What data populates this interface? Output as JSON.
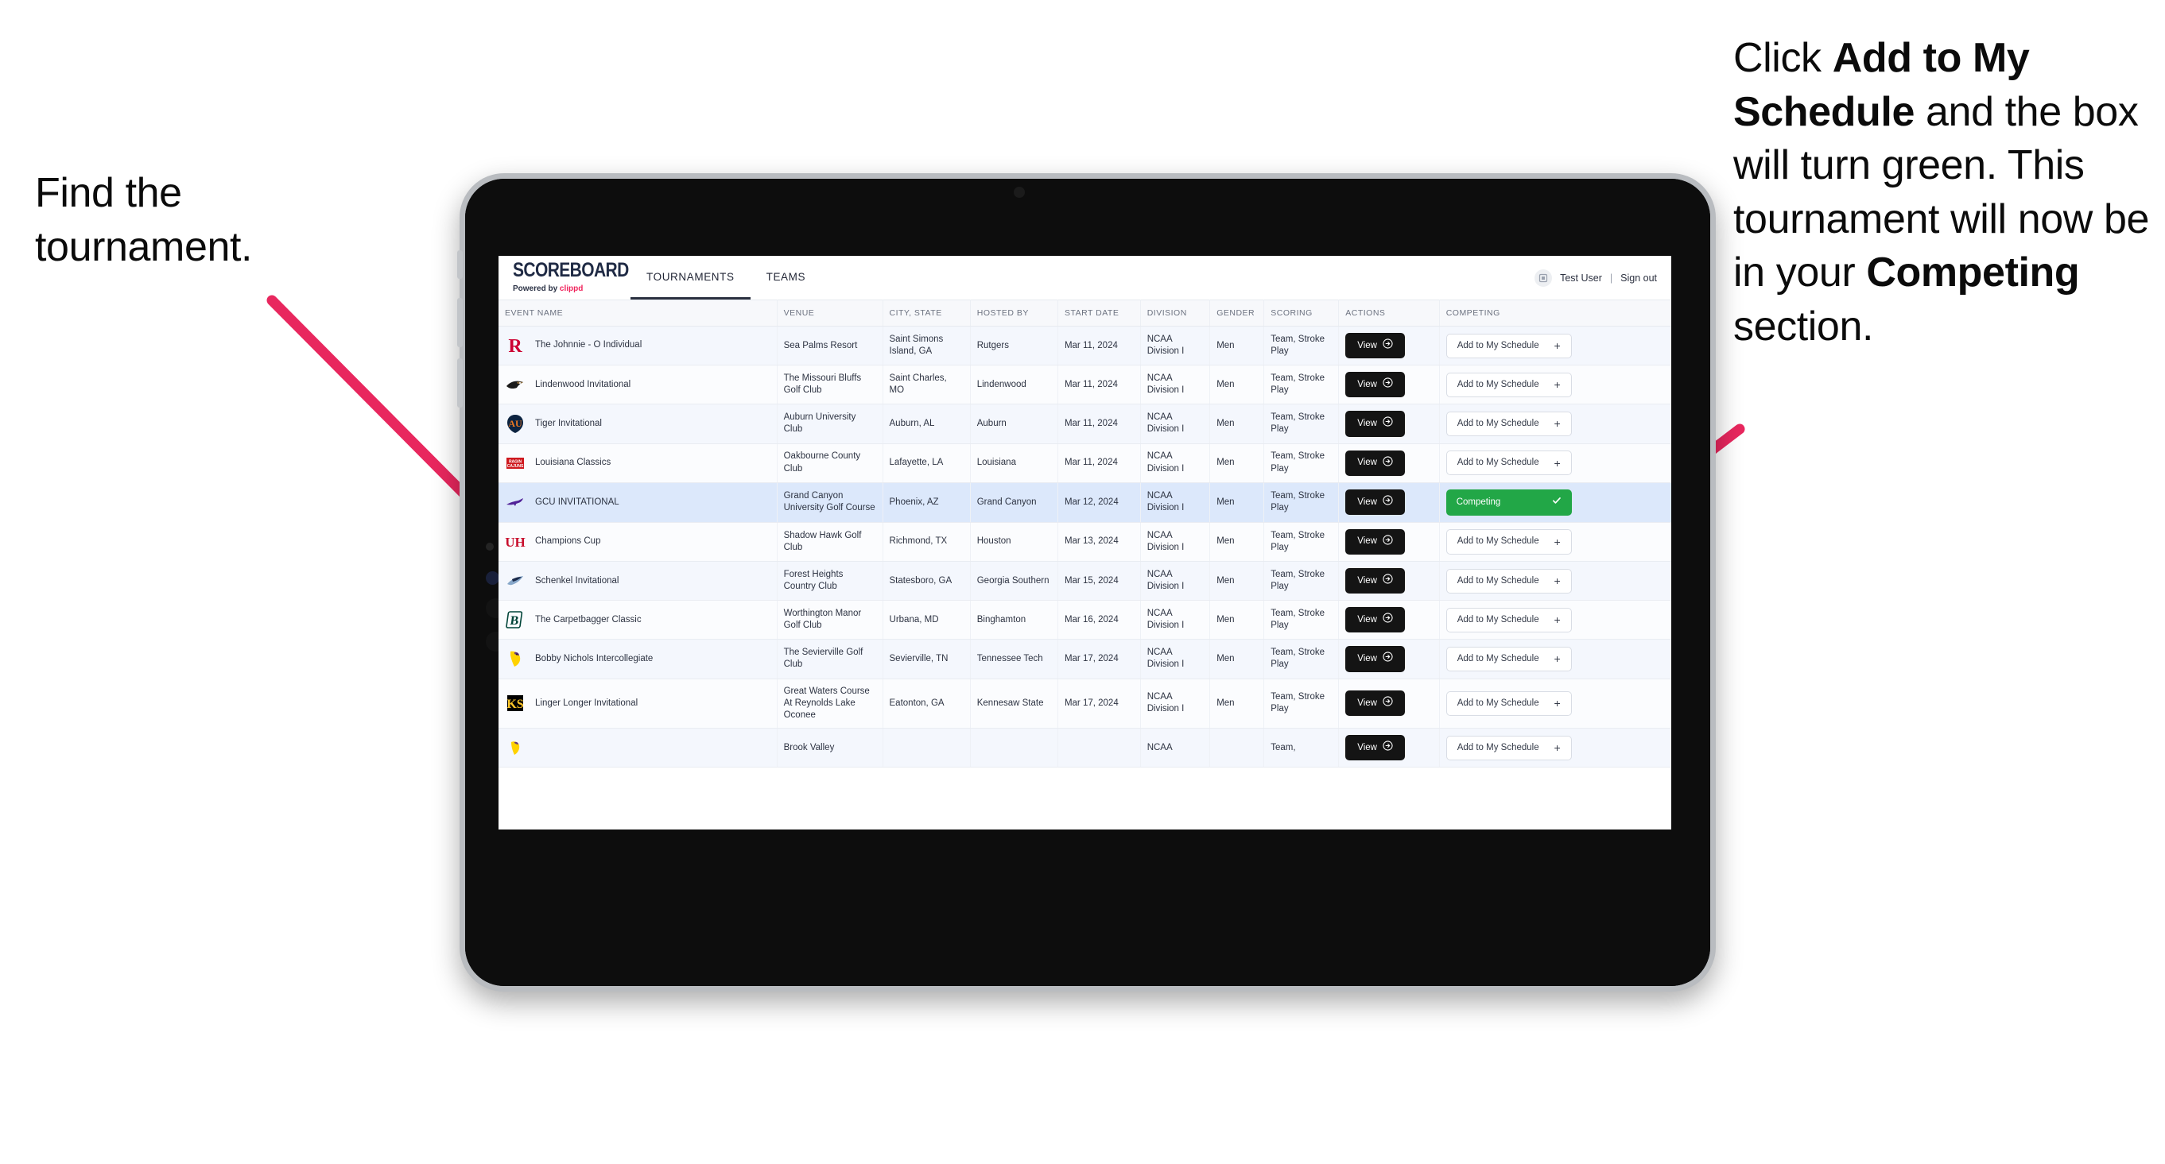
{
  "annotations": {
    "left": "Find the tournament.",
    "right_parts": [
      {
        "text": "Click ",
        "bold": false
      },
      {
        "text": "Add to My Schedule",
        "bold": true
      },
      {
        "text": " and the box will turn green. This tournament will now be in your ",
        "bold": false
      },
      {
        "text": "Competing",
        "bold": true
      },
      {
        "text": " section.",
        "bold": false
      }
    ]
  },
  "colors": {
    "arrow": "#e8275e",
    "competing_green": "#22a747",
    "clippd_pink": "#f0245c",
    "highlight_row": "#dce8fb",
    "view_button": "#141414"
  },
  "app": {
    "brand": {
      "title": "SCOREBOARD",
      "powered_prefix": "Powered by ",
      "powered_brand": "clippd"
    },
    "nav": [
      {
        "label": "TOURNAMENTS",
        "active": true
      },
      {
        "label": "TEAMS",
        "active": false
      }
    ],
    "user": {
      "name": "Test User",
      "separator": "|",
      "sign_out": "Sign out",
      "avatar_icon": "user-avatar-icon"
    },
    "table": {
      "columns": [
        "EVENT NAME",
        "VENUE",
        "CITY, STATE",
        "HOSTED BY",
        "START DATE",
        "DIVISION",
        "GENDER",
        "SCORING",
        "ACTIONS",
        "COMPETING"
      ],
      "view_label": "View",
      "add_label": "Add to My Schedule",
      "add_icon": "plus-icon",
      "competing_label": "Competing",
      "competing_icon": "check-icon",
      "rows": [
        {
          "event": "The Johnnie - O Individual",
          "venue": "Sea Palms Resort",
          "city": "Saint Simons Island, GA",
          "host": "Rutgers",
          "date": "Mar 11, 2024",
          "division": "NCAA Division I",
          "gender": "Men",
          "scoring": "Team, Stroke Play",
          "competing": false,
          "logo": "rutgers-r-logo"
        },
        {
          "event": "Lindenwood Invitational",
          "venue": "The Missouri Bluffs Golf Club",
          "city": "Saint Charles, MO",
          "host": "Lindenwood",
          "date": "Mar 11, 2024",
          "division": "NCAA Division I",
          "gender": "Men",
          "scoring": "Team, Stroke Play",
          "competing": false,
          "logo": "lindenwood-lion-logo"
        },
        {
          "event": "Tiger Invitational",
          "venue": "Auburn University Club",
          "city": "Auburn, AL",
          "host": "Auburn",
          "date": "Mar 11, 2024",
          "division": "NCAA Division I",
          "gender": "Men",
          "scoring": "Team, Stroke Play",
          "competing": false,
          "logo": "auburn-au-logo"
        },
        {
          "event": "Louisiana Classics",
          "venue": "Oakbourne County Club",
          "city": "Lafayette, LA",
          "host": "Louisiana",
          "date": "Mar 11, 2024",
          "division": "NCAA Division I",
          "gender": "Men",
          "scoring": "Team, Stroke Play",
          "competing": false,
          "logo": "ragin-cajuns-logo"
        },
        {
          "event": "GCU INVITATIONAL",
          "venue": "Grand Canyon University Golf Course",
          "city": "Phoenix, AZ",
          "host": "Grand Canyon",
          "date": "Mar 12, 2024",
          "division": "NCAA Division I",
          "gender": "Men",
          "scoring": "Team, Stroke Play",
          "competing": true,
          "logo": "grand-canyon-lopes-logo"
        },
        {
          "event": "Champions Cup",
          "venue": "Shadow Hawk Golf Club",
          "city": "Richmond, TX",
          "host": "Houston",
          "date": "Mar 13, 2024",
          "division": "NCAA Division I",
          "gender": "Men",
          "scoring": "Team, Stroke Play",
          "competing": false,
          "logo": "houston-uh-logo"
        },
        {
          "event": "Schenkel Invitational",
          "venue": "Forest Heights Country Club",
          "city": "Statesboro, GA",
          "host": "Georgia Southern",
          "date": "Mar 15, 2024",
          "division": "NCAA Division I",
          "gender": "Men",
          "scoring": "Team, Stroke Play",
          "competing": false,
          "logo": "georgia-southern-eagle-logo"
        },
        {
          "event": "The Carpetbagger Classic",
          "venue": "Worthington Manor Golf Club",
          "city": "Urbana, MD",
          "host": "Binghamton",
          "date": "Mar 16, 2024",
          "division": "NCAA Division I",
          "gender": "Men",
          "scoring": "Team, Stroke Play",
          "competing": false,
          "logo": "binghamton-b-logo"
        },
        {
          "event": "Bobby Nichols Intercollegiate",
          "venue": "The Sevierville Golf Club",
          "city": "Sevierville, TN",
          "host": "Tennessee Tech",
          "date": "Mar 17, 2024",
          "division": "NCAA Division I",
          "gender": "Men",
          "scoring": "Team, Stroke Play",
          "competing": false,
          "logo": "tennessee-tech-eagle-logo"
        },
        {
          "event": "Linger Longer Invitational",
          "venue": "Great Waters Course At Reynolds Lake Oconee",
          "city": "Eatonton, GA",
          "host": "Kennesaw State",
          "date": "Mar 17, 2024",
          "division": "NCAA Division I",
          "gender": "Men",
          "scoring": "Team, Stroke Play",
          "competing": false,
          "logo": "kennesaw-state-ks-logo"
        },
        {
          "event": "",
          "venue": "Brook Valley",
          "city": "",
          "host": "",
          "date": "",
          "division": "NCAA",
          "gender": "",
          "scoring": "Team,",
          "competing": false,
          "logo": "partial-row-logo",
          "partial": true
        }
      ]
    }
  }
}
